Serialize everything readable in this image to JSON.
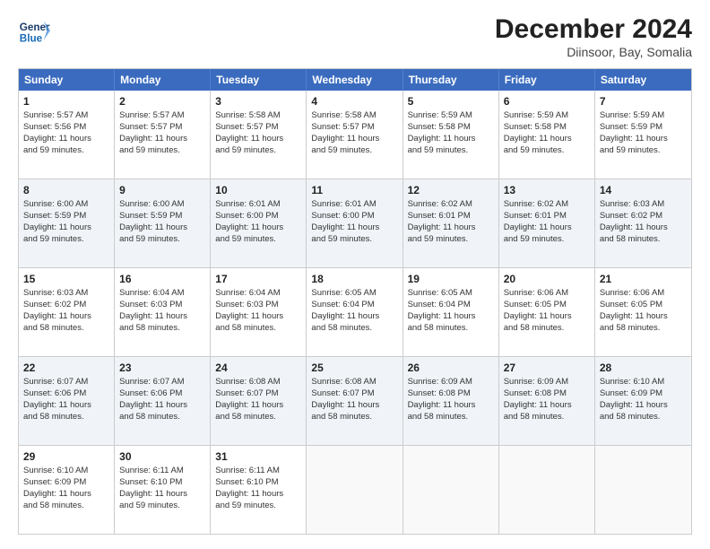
{
  "logo": {
    "line1": "General",
    "line2": "Blue"
  },
  "title": "December 2024",
  "subtitle": "Diinsoor, Bay, Somalia",
  "header_days": [
    "Sunday",
    "Monday",
    "Tuesday",
    "Wednesday",
    "Thursday",
    "Friday",
    "Saturday"
  ],
  "rows": [
    [
      {
        "day": "1",
        "lines": [
          "Sunrise: 5:57 AM",
          "Sunset: 5:56 PM",
          "Daylight: 11 hours",
          "and 59 minutes."
        ]
      },
      {
        "day": "2",
        "lines": [
          "Sunrise: 5:57 AM",
          "Sunset: 5:57 PM",
          "Daylight: 11 hours",
          "and 59 minutes."
        ]
      },
      {
        "day": "3",
        "lines": [
          "Sunrise: 5:58 AM",
          "Sunset: 5:57 PM",
          "Daylight: 11 hours",
          "and 59 minutes."
        ]
      },
      {
        "day": "4",
        "lines": [
          "Sunrise: 5:58 AM",
          "Sunset: 5:57 PM",
          "Daylight: 11 hours",
          "and 59 minutes."
        ]
      },
      {
        "day": "5",
        "lines": [
          "Sunrise: 5:59 AM",
          "Sunset: 5:58 PM",
          "Daylight: 11 hours",
          "and 59 minutes."
        ]
      },
      {
        "day": "6",
        "lines": [
          "Sunrise: 5:59 AM",
          "Sunset: 5:58 PM",
          "Daylight: 11 hours",
          "and 59 minutes."
        ]
      },
      {
        "day": "7",
        "lines": [
          "Sunrise: 5:59 AM",
          "Sunset: 5:59 PM",
          "Daylight: 11 hours",
          "and 59 minutes."
        ]
      }
    ],
    [
      {
        "day": "8",
        "lines": [
          "Sunrise: 6:00 AM",
          "Sunset: 5:59 PM",
          "Daylight: 11 hours",
          "and 59 minutes."
        ]
      },
      {
        "day": "9",
        "lines": [
          "Sunrise: 6:00 AM",
          "Sunset: 5:59 PM",
          "Daylight: 11 hours",
          "and 59 minutes."
        ]
      },
      {
        "day": "10",
        "lines": [
          "Sunrise: 6:01 AM",
          "Sunset: 6:00 PM",
          "Daylight: 11 hours",
          "and 59 minutes."
        ]
      },
      {
        "day": "11",
        "lines": [
          "Sunrise: 6:01 AM",
          "Sunset: 6:00 PM",
          "Daylight: 11 hours",
          "and 59 minutes."
        ]
      },
      {
        "day": "12",
        "lines": [
          "Sunrise: 6:02 AM",
          "Sunset: 6:01 PM",
          "Daylight: 11 hours",
          "and 59 minutes."
        ]
      },
      {
        "day": "13",
        "lines": [
          "Sunrise: 6:02 AM",
          "Sunset: 6:01 PM",
          "Daylight: 11 hours",
          "and 59 minutes."
        ]
      },
      {
        "day": "14",
        "lines": [
          "Sunrise: 6:03 AM",
          "Sunset: 6:02 PM",
          "Daylight: 11 hours",
          "and 58 minutes."
        ]
      }
    ],
    [
      {
        "day": "15",
        "lines": [
          "Sunrise: 6:03 AM",
          "Sunset: 6:02 PM",
          "Daylight: 11 hours",
          "and 58 minutes."
        ]
      },
      {
        "day": "16",
        "lines": [
          "Sunrise: 6:04 AM",
          "Sunset: 6:03 PM",
          "Daylight: 11 hours",
          "and 58 minutes."
        ]
      },
      {
        "day": "17",
        "lines": [
          "Sunrise: 6:04 AM",
          "Sunset: 6:03 PM",
          "Daylight: 11 hours",
          "and 58 minutes."
        ]
      },
      {
        "day": "18",
        "lines": [
          "Sunrise: 6:05 AM",
          "Sunset: 6:04 PM",
          "Daylight: 11 hours",
          "and 58 minutes."
        ]
      },
      {
        "day": "19",
        "lines": [
          "Sunrise: 6:05 AM",
          "Sunset: 6:04 PM",
          "Daylight: 11 hours",
          "and 58 minutes."
        ]
      },
      {
        "day": "20",
        "lines": [
          "Sunrise: 6:06 AM",
          "Sunset: 6:05 PM",
          "Daylight: 11 hours",
          "and 58 minutes."
        ]
      },
      {
        "day": "21",
        "lines": [
          "Sunrise: 6:06 AM",
          "Sunset: 6:05 PM",
          "Daylight: 11 hours",
          "and 58 minutes."
        ]
      }
    ],
    [
      {
        "day": "22",
        "lines": [
          "Sunrise: 6:07 AM",
          "Sunset: 6:06 PM",
          "Daylight: 11 hours",
          "and 58 minutes."
        ]
      },
      {
        "day": "23",
        "lines": [
          "Sunrise: 6:07 AM",
          "Sunset: 6:06 PM",
          "Daylight: 11 hours",
          "and 58 minutes."
        ]
      },
      {
        "day": "24",
        "lines": [
          "Sunrise: 6:08 AM",
          "Sunset: 6:07 PM",
          "Daylight: 11 hours",
          "and 58 minutes."
        ]
      },
      {
        "day": "25",
        "lines": [
          "Sunrise: 6:08 AM",
          "Sunset: 6:07 PM",
          "Daylight: 11 hours",
          "and 58 minutes."
        ]
      },
      {
        "day": "26",
        "lines": [
          "Sunrise: 6:09 AM",
          "Sunset: 6:08 PM",
          "Daylight: 11 hours",
          "and 58 minutes."
        ]
      },
      {
        "day": "27",
        "lines": [
          "Sunrise: 6:09 AM",
          "Sunset: 6:08 PM",
          "Daylight: 11 hours",
          "and 58 minutes."
        ]
      },
      {
        "day": "28",
        "lines": [
          "Sunrise: 6:10 AM",
          "Sunset: 6:09 PM",
          "Daylight: 11 hours",
          "and 58 minutes."
        ]
      }
    ],
    [
      {
        "day": "29",
        "lines": [
          "Sunrise: 6:10 AM",
          "Sunset: 6:09 PM",
          "Daylight: 11 hours",
          "and 58 minutes."
        ]
      },
      {
        "day": "30",
        "lines": [
          "Sunrise: 6:11 AM",
          "Sunset: 6:10 PM",
          "Daylight: 11 hours",
          "and 59 minutes."
        ]
      },
      {
        "day": "31",
        "lines": [
          "Sunrise: 6:11 AM",
          "Sunset: 6:10 PM",
          "Daylight: 11 hours",
          "and 59 minutes."
        ]
      },
      {
        "day": "",
        "lines": []
      },
      {
        "day": "",
        "lines": []
      },
      {
        "day": "",
        "lines": []
      },
      {
        "day": "",
        "lines": []
      }
    ]
  ],
  "alt_rows": [
    1,
    3
  ]
}
